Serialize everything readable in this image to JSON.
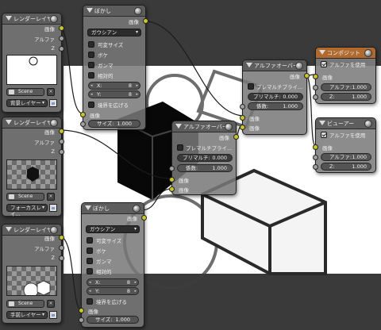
{
  "nodes": {
    "render1": {
      "title": "レンダーレイヤー",
      "outputs": [
        "画像",
        "アルファ",
        "Z"
      ],
      "scene": "Scene",
      "layer": "背景レイヤー"
    },
    "render2": {
      "title": "レンダーレイヤー",
      "outputs": [
        "画像",
        "アルファ",
        "Z"
      ],
      "scene": "Scene",
      "layer": "フォーカスレイ..."
    },
    "render3": {
      "title": "レンダーレイヤー",
      "outputs": [
        "画像",
        "アルファ",
        "Z"
      ],
      "scene": "Scene",
      "layer": "手前レイヤー"
    },
    "blur1": {
      "title": "ぼかし",
      "output": "画像",
      "filter": "ガウシアン",
      "options": [
        "可変サイズ",
        "ボケ",
        "ガンマ",
        "相対的"
      ],
      "x_label": "X:",
      "x_value": "8",
      "y_label": "Y:",
      "y_value": "8",
      "extend": "境界を広げる",
      "input_image": "画像",
      "size_label": "サイズ:",
      "size_value": "1.000"
    },
    "blur2": {
      "title": "ぼかし",
      "output": "画像",
      "filter": "ガウシアン",
      "options": [
        "可変サイズ",
        "ボケ",
        "ガンマ",
        "相対的"
      ],
      "x_label": "X:",
      "x_value": "8",
      "y_label": "Y:",
      "y_value": "8",
      "extend": "境界を広げる",
      "input_image": "画像",
      "size_label": "サイズ:",
      "size_value": "1.000"
    },
    "alpha1": {
      "title": "アルファオーバー",
      "output": "画像",
      "premul_check": "プレマルチプライ...",
      "premul_label": "プリマルチ:",
      "premul_value": "0.000",
      "factor_label": "係数:",
      "factor_value": "1.000",
      "inputs": [
        "画像",
        "画像"
      ]
    },
    "alpha2": {
      "title": "アルファオーバー",
      "output": "画像",
      "premul_check": "プレマルチプライ...",
      "premul_label": "プリマルチ:",
      "premul_value": "0.000",
      "factor_label": "係数:",
      "factor_value": "1.000",
      "inputs": [
        "画像",
        "画像"
      ]
    },
    "composite": {
      "title": "コンポジット",
      "use_alpha": "アルファを使用",
      "image": "画像",
      "alpha_label": "アルファ:",
      "alpha_value": "1.000",
      "z_label": "Z:",
      "z_value": "1.000"
    },
    "viewer": {
      "title": "ビューアー",
      "use_alpha": "アルファを使用",
      "image": "画像",
      "alpha_label": "アルファ:",
      "alpha_value": "1.000",
      "z_label": "Z:",
      "z_value": "1.000"
    }
  },
  "colors": {
    "image_socket": "#c7c729",
    "value_socket": "#a0a0a0",
    "vector_socket": "#6363c7",
    "composite_header": "#b06a2e",
    "backdrop": "#ffffff"
  }
}
